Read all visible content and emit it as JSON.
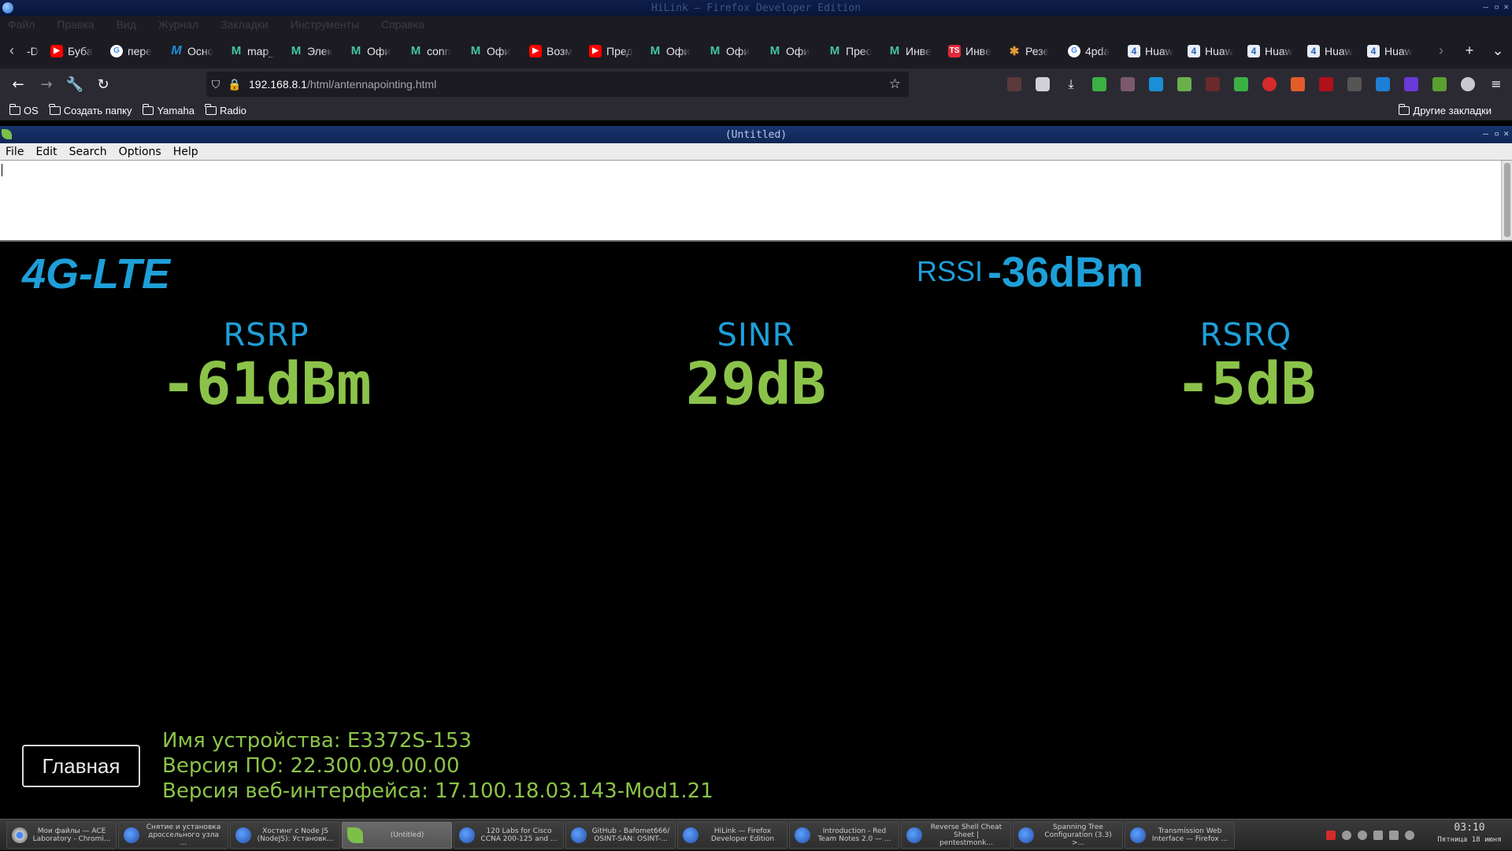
{
  "window": {
    "title": "HiLink — Firefox Developer Edition"
  },
  "menubar": [
    "Файл",
    "Правка",
    "Вид",
    "Журнал",
    "Закладки",
    "Инструменты",
    "Справка"
  ],
  "tabs": [
    {
      "label": "-D",
      "icon": "none"
    },
    {
      "label": "Буба",
      "icon": "youtube"
    },
    {
      "label": "пере",
      "icon": "google"
    },
    {
      "label": "Осно",
      "icon": "medium"
    },
    {
      "label": "map_",
      "icon": "m-green"
    },
    {
      "label": "Элек",
      "icon": "m-green"
    },
    {
      "label": "Офи",
      "icon": "m-green"
    },
    {
      "label": "conn",
      "icon": "m-green"
    },
    {
      "label": "Офи",
      "icon": "m-green"
    },
    {
      "label": "Возм",
      "icon": "youtube"
    },
    {
      "label": "Пред",
      "icon": "youtube"
    },
    {
      "label": "Офи",
      "icon": "m-green"
    },
    {
      "label": "Офи",
      "icon": "m-green"
    },
    {
      "label": "Офи",
      "icon": "m-green"
    },
    {
      "label": "Прео",
      "icon": "m-green"
    },
    {
      "label": "Инве",
      "icon": "m-green"
    },
    {
      "label": "Инве",
      "icon": "ts"
    },
    {
      "label": "Резе",
      "icon": "sun"
    },
    {
      "label": "4pda",
      "icon": "google"
    },
    {
      "label": "Huaw",
      "icon": "4pda"
    },
    {
      "label": "Huaw",
      "icon": "4pda"
    },
    {
      "label": "Huaw",
      "icon": "4pda"
    },
    {
      "label": "Huaw",
      "icon": "4pda"
    },
    {
      "label": "Huaw",
      "icon": "4pda"
    }
  ],
  "navbar": {
    "url_host": "192.168.8.1",
    "url_path": "/html/antennapointing.html"
  },
  "bookmarks": {
    "items": [
      "OS",
      "Создать папку",
      "Yamaha",
      "Radio"
    ],
    "other": "Другие закладки"
  },
  "editor": {
    "title": "(Untitled)",
    "menu": [
      "File",
      "Edit",
      "Search",
      "Options",
      "Help"
    ],
    "content": ""
  },
  "hilink": {
    "network_mode": "4G-LTE",
    "rssi_label": "RSSI",
    "rssi_value": "-36dBm",
    "metrics": [
      {
        "label": "RSRP",
        "value": "-61dBm"
      },
      {
        "label": "SINR",
        "value": "29dB"
      },
      {
        "label": "RSRQ",
        "value": "-5dB"
      }
    ],
    "home_button": "Главная",
    "device_info": [
      "Имя устройства: E3372S-153",
      "Версия ПО: 22.300.09.00.00",
      "Версия веб-интерфейса: 17.100.18.03.143-Mod1.21"
    ],
    "colors": {
      "label": "#1e9fd8",
      "value": "#8bc34a"
    }
  },
  "taskbar": {
    "tasks": [
      {
        "line1": "Мои файлы — ACE",
        "line2": "Laboratory - Chromi...",
        "icon": "chrome"
      },
      {
        "line1": "Снятие и установка",
        "line2": "дроссельного узла ...",
        "icon": "firefox"
      },
      {
        "line1": "Хостинг с Node JS",
        "line2": "(NodeJS): Установк...",
        "icon": "firefox"
      },
      {
        "line1": "(Untitled)",
        "line2": "",
        "icon": "leafpad",
        "active": true
      },
      {
        "line1": "120 Labs for Cisco",
        "line2": "CCNA 200-125 and ...",
        "icon": "firefox"
      },
      {
        "line1": "GitHub - Bafomet666/",
        "line2": "OSINT-SAN: OSINT-...",
        "icon": "firefox"
      },
      {
        "line1": "HiLink — Firefox",
        "line2": "Developer Edition",
        "icon": "firefox"
      },
      {
        "line1": "Introduction - Red",
        "line2": "Team Notes 2.0 — ...",
        "icon": "firefox"
      },
      {
        "line1": "Reverse Shell Cheat",
        "line2": "Sheet | pentestmonk...",
        "icon": "firefox"
      },
      {
        "line1": "Spanning Tree",
        "line2": "Configuration (3.3) >...",
        "icon": "firefox"
      },
      {
        "line1": "Transmission Web",
        "line2": "Interface — Firefox ...",
        "icon": "firefox"
      }
    ],
    "clock_time": "03:10",
    "clock_date": "Пятница 18 июня"
  }
}
